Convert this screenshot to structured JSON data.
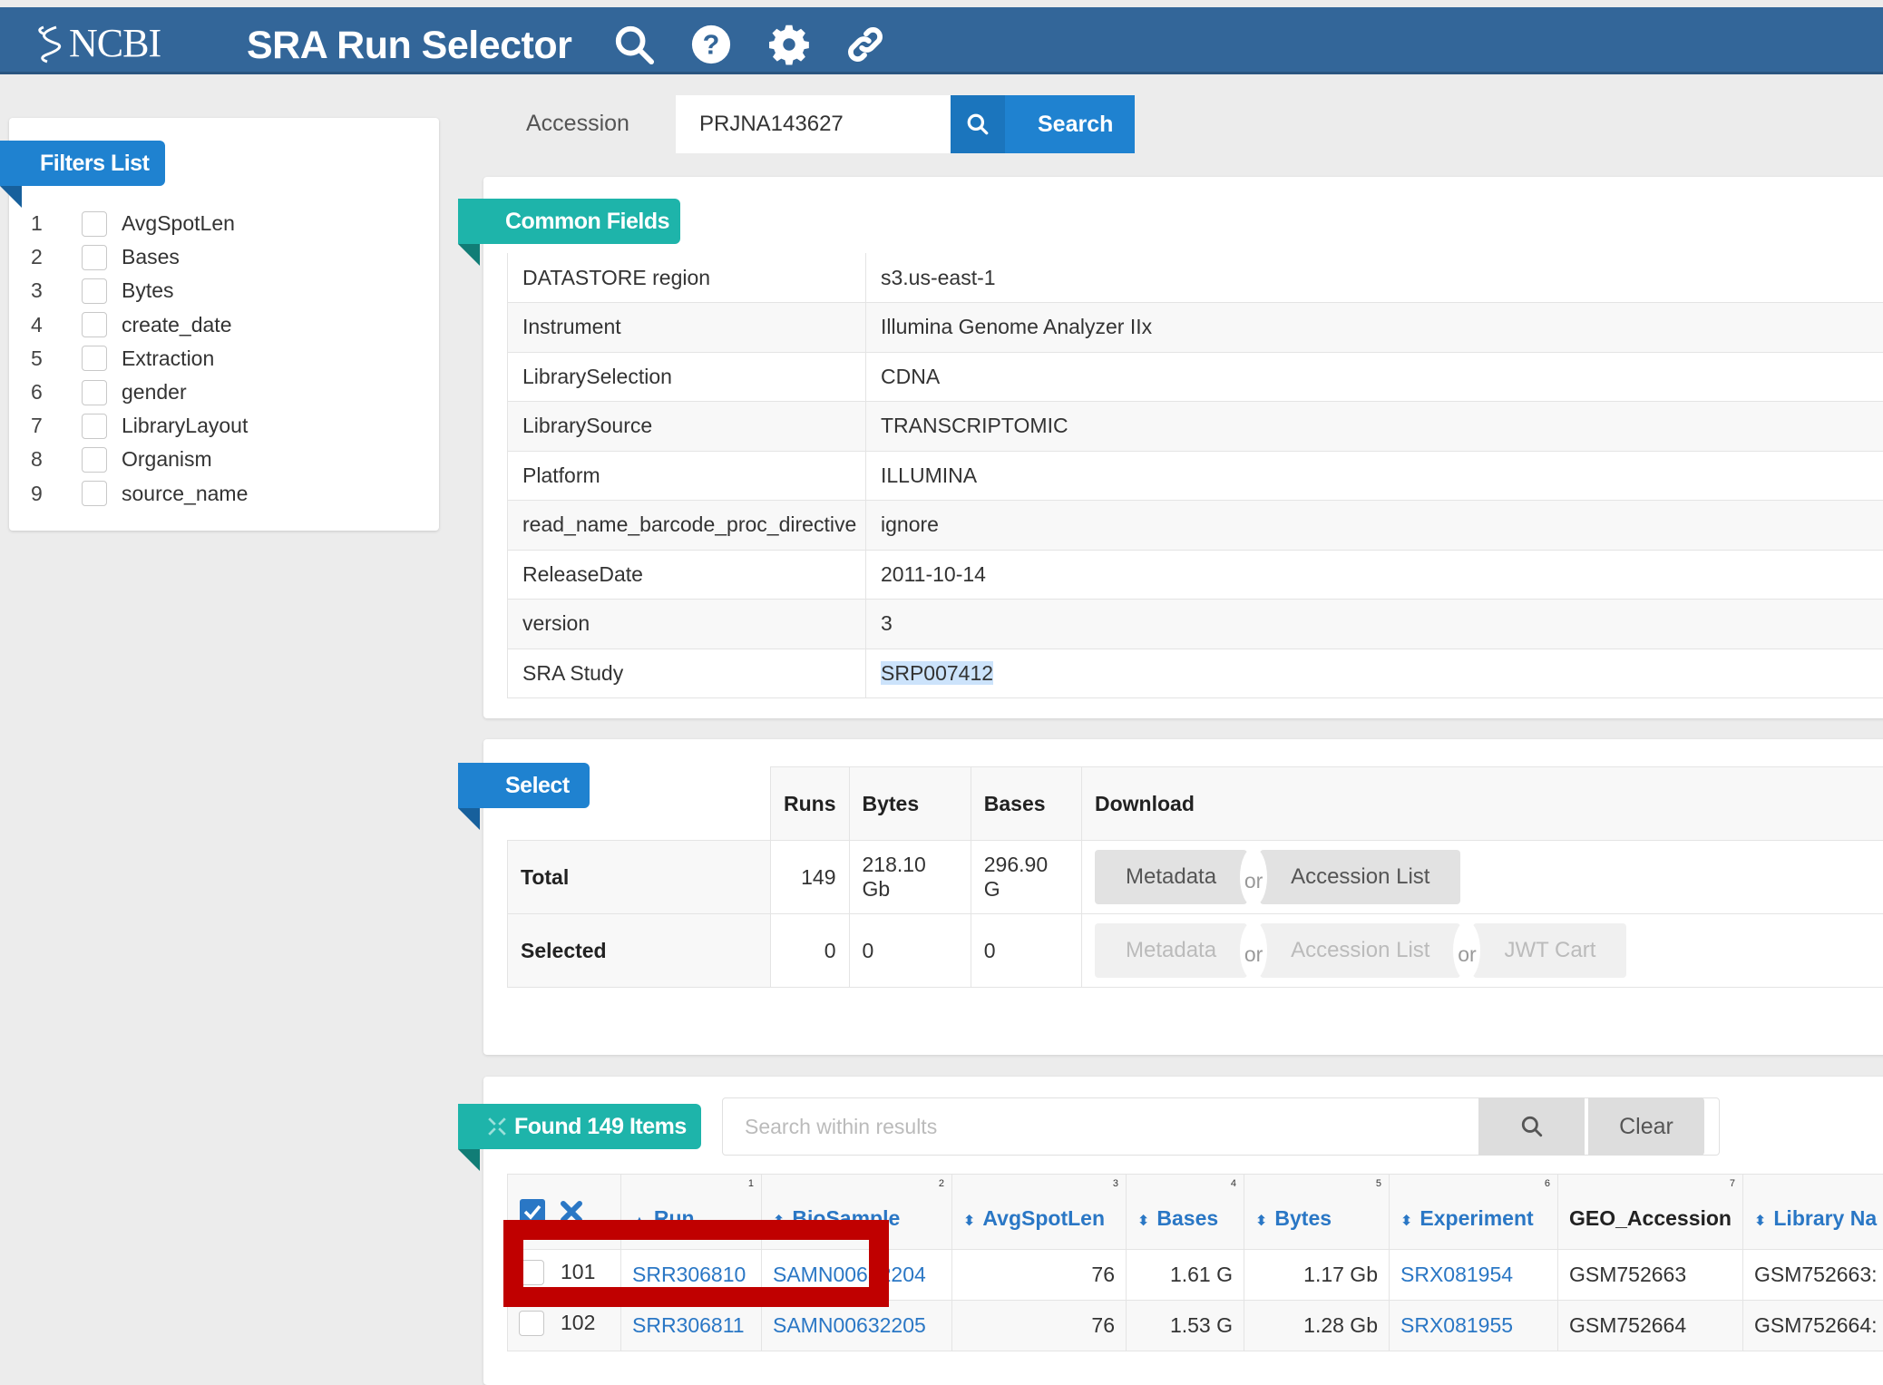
{
  "header": {
    "logo_text": "NCBI",
    "app_title": "SRA Run Selector",
    "icons": [
      "search-icon",
      "help-icon",
      "gear-icon",
      "link-icon"
    ]
  },
  "accession": {
    "label": "Accession",
    "value": "PRJNA143627",
    "search_label": "Search"
  },
  "filters": {
    "title": "Filters List",
    "items": [
      {
        "num": "1",
        "label": "AvgSpotLen"
      },
      {
        "num": "2",
        "label": "Bases"
      },
      {
        "num": "3",
        "label": "Bytes"
      },
      {
        "num": "4",
        "label": "create_date"
      },
      {
        "num": "5",
        "label": "Extraction"
      },
      {
        "num": "6",
        "label": "gender"
      },
      {
        "num": "7",
        "label": "LibraryLayout"
      },
      {
        "num": "8",
        "label": "Organism"
      },
      {
        "num": "9",
        "label": "source_name"
      }
    ]
  },
  "common_fields": {
    "title": "Common Fields",
    "rows": [
      {
        "key": "DATASTORE region",
        "value": "s3.us-east-1"
      },
      {
        "key": "Instrument",
        "value": "Illumina Genome Analyzer IIx"
      },
      {
        "key": "LibrarySelection",
        "value": "CDNA"
      },
      {
        "key": "LibrarySource",
        "value": "TRANSCRIPTOMIC"
      },
      {
        "key": "Platform",
        "value": "ILLUMINA"
      },
      {
        "key": "read_name_barcode_proc_directive",
        "value": "ignore"
      },
      {
        "key": "ReleaseDate",
        "value": "2011-10-14"
      },
      {
        "key": "version",
        "value": "3"
      },
      {
        "key": "SRA Study",
        "value": "SRP007412"
      }
    ]
  },
  "select": {
    "title": "Select",
    "headers": {
      "runs": "Runs",
      "bytes": "Bytes",
      "bases": "Bases",
      "download": "Download"
    },
    "total": {
      "label": "Total",
      "runs": "149",
      "bytes": "218.10 Gb",
      "bases": "296.90 G"
    },
    "selected": {
      "label": "Selected",
      "runs": "0",
      "bytes": "0",
      "bases": "0"
    },
    "buttons": {
      "metadata": "Metadata",
      "accession_list": "Accession List",
      "jwt_cart": "JWT Cart",
      "or": "or"
    }
  },
  "found": {
    "title": "Found 149 Items",
    "search_placeholder": "Search within results",
    "clear_label": "Clear",
    "columns": [
      {
        "label": "Run",
        "idx": "1",
        "sort": "▲"
      },
      {
        "label": "BioSample",
        "idx": "2",
        "sort": "⬍"
      },
      {
        "label": "AvgSpotLen",
        "idx": "3",
        "sort": "⬍"
      },
      {
        "label": "Bases",
        "idx": "4",
        "sort": "⬍"
      },
      {
        "label": "Bytes",
        "idx": "5",
        "sort": "⬍"
      },
      {
        "label": "Experiment",
        "idx": "6",
        "sort": "⬍"
      },
      {
        "label": "GEO_Accession",
        "idx": "7",
        "sort": ""
      },
      {
        "label": "Library Na",
        "idx": "",
        "sort": "⬍"
      }
    ],
    "rows": [
      {
        "n": "101",
        "run": "SRR306810",
        "biosample": "SAMN00632204",
        "avgspotlen": "76",
        "bases": "1.61 G",
        "bytes": "1.17 Gb",
        "experiment": "SRX081954",
        "geo": "GSM752663",
        "library": "GSM752663:"
      },
      {
        "n": "102",
        "run": "SRR306811",
        "biosample": "SAMN00632205",
        "avgspotlen": "76",
        "bases": "1.53 G",
        "bytes": "1.28 Gb",
        "experiment": "SRX081955",
        "geo": "GSM752664",
        "library": "GSM752664:"
      }
    ]
  },
  "annotation": {
    "highlight_color": "#c00000"
  }
}
